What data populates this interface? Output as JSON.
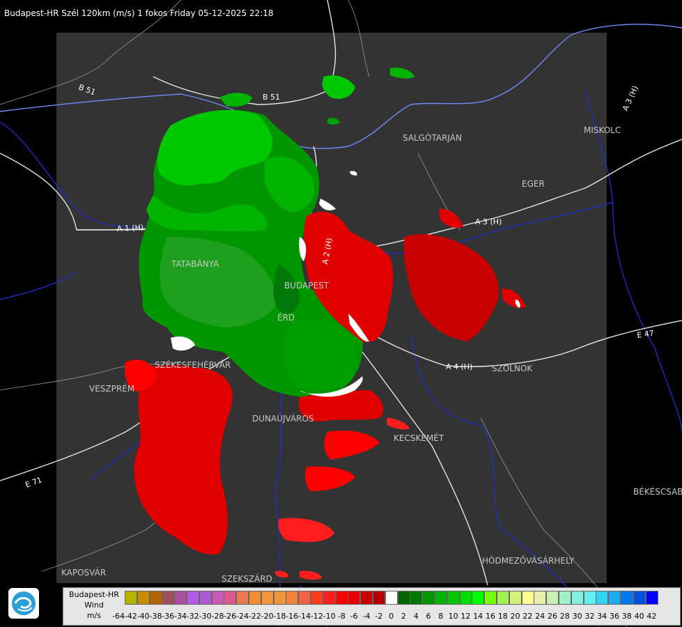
{
  "title": "Budapest-HR Szél 120km (m/s) 1 fokos Friday 05-12-2025 22:18",
  "cities": [
    "SALGÓTARJÁN",
    "MISKOLC",
    "EGER",
    "TATABÁNYA",
    "BUDAPEST",
    "ÉRD",
    "SZÉKESFEHÉRVÁR",
    "VESZPRÉM",
    "SZOLNOK",
    "DUNAÚJVÁROS",
    "KECSKEMÉT",
    "BÉKÉSCSABA",
    "KAPOSVÁR",
    "SZEKSZÁRD",
    "HÓDMEZŐVÁSÁRHELY"
  ],
  "roads": [
    "B 51",
    "B 51",
    "A 1 (H)",
    "A 2 (H)",
    "A 3 (H)",
    "A 3 (H)",
    "A 4 (H)",
    "E 47",
    "E 71"
  ],
  "legend": {
    "name": "Budapest-HR",
    "quantity": "Wind",
    "unit": "m/s",
    "ticks": [
      "-64",
      "-42",
      "-40",
      "-38",
      "-36",
      "-34",
      "-32",
      "-30",
      "-28",
      "-26",
      "-24",
      "-22",
      "-20",
      "-18",
      "-16",
      "-14",
      "-12",
      "-10",
      "-8",
      "-6",
      "-4",
      "-2",
      "0",
      "2",
      "4",
      "6",
      "8",
      "10",
      "12",
      "14",
      "16",
      "18",
      "20",
      "22",
      "24",
      "26",
      "28",
      "30",
      "32",
      "34",
      "36",
      "38",
      "40",
      "42"
    ],
    "colors": [
      "#d0d0d0",
      "#b4b400",
      "#c88c00",
      "#b46400",
      "#a0505a",
      "#aa50a0",
      "#b45ae6",
      "#aa5ad2",
      "#c85ab4",
      "#dc5a8c",
      "#f07850",
      "#f08c32",
      "#f0963c",
      "#f0963c",
      "#f0823c",
      "#f06446",
      "#ff3c1e",
      "#ff1e1e",
      "#ff0000",
      "#e60000",
      "#c80000",
      "#b40000",
      "#ffffff",
      "#006400",
      "#007800",
      "#009600",
      "#00b400",
      "#00c800",
      "#00dc00",
      "#00ff00",
      "#78ff00",
      "#a0f050",
      "#d2f07a",
      "#ffff96",
      "#e6f0aa",
      "#c8f0b4",
      "#a0f0c8",
      "#82f0dc",
      "#64f0f0",
      "#32d2f0",
      "#1eaaf0",
      "#0078f0",
      "#0050dc",
      "#0000ff"
    ]
  }
}
